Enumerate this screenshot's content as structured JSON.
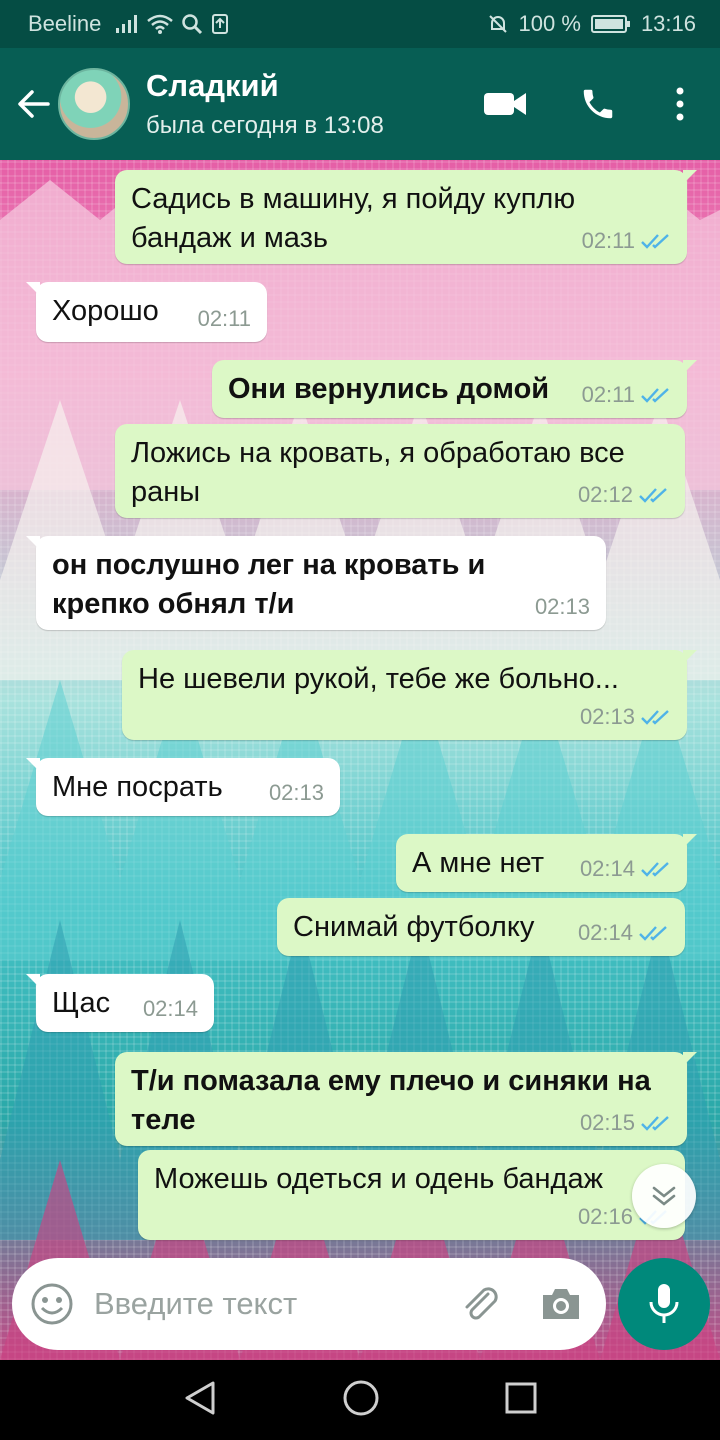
{
  "statusbar": {
    "carrier": "Beeline",
    "battery": "100 %",
    "time": "13:16"
  },
  "header": {
    "name": "Сладкий",
    "status": "была сегодня в 13:08"
  },
  "messages": [
    {
      "dir": "out",
      "text": "Садись в машину, я пойду куплю бандаж и мазь",
      "time": "02:11",
      "bold": false
    },
    {
      "dir": "in",
      "text": "Хорошо",
      "time": "02:11",
      "bold": false
    },
    {
      "dir": "out",
      "text": "Они вернулись домой",
      "time": "02:11",
      "bold": true
    },
    {
      "dir": "out",
      "text": "Ложись на кровать, я обработаю все раны",
      "time": "02:12",
      "bold": false
    },
    {
      "dir": "in",
      "text": "он послушно лег на кровать и крепко обнял т/и",
      "time": "02:13",
      "bold": true
    },
    {
      "dir": "out",
      "text": "Не шевели рукой, тебе же больно...",
      "time": "02:13",
      "bold": false
    },
    {
      "dir": "in",
      "text": "Мне посрать",
      "time": "02:13",
      "bold": false
    },
    {
      "dir": "out",
      "text": "А мне нет",
      "time": "02:14",
      "bold": false
    },
    {
      "dir": "out",
      "text": "Снимай футболку",
      "time": "02:14",
      "bold": false
    },
    {
      "dir": "in",
      "text": "Щас",
      "time": "02:14",
      "bold": false
    },
    {
      "dir": "out",
      "text": "Т/и помазала ему плечо и синяки на теле",
      "time": "02:15",
      "bold": true
    },
    {
      "dir": "out",
      "text": "Можешь одеться и  одень бандаж",
      "time": "02:16",
      "bold": false
    }
  ],
  "input": {
    "placeholder": "Введите текст"
  },
  "colors": {
    "header": "#075e54",
    "statusbar": "#054d44",
    "bubble_out": "#dcf8c6",
    "bubble_in": "#ffffff",
    "read_ticks": "#4fb3e8",
    "mic": "#00897b"
  },
  "icons": [
    "back-arrow-icon",
    "video-call-icon",
    "phone-icon",
    "more-vert-icon",
    "emoji-icon",
    "attach-icon",
    "camera-icon",
    "mic-icon",
    "scroll-down-icon",
    "nav-back-icon",
    "nav-home-icon",
    "nav-recents-icon"
  ]
}
